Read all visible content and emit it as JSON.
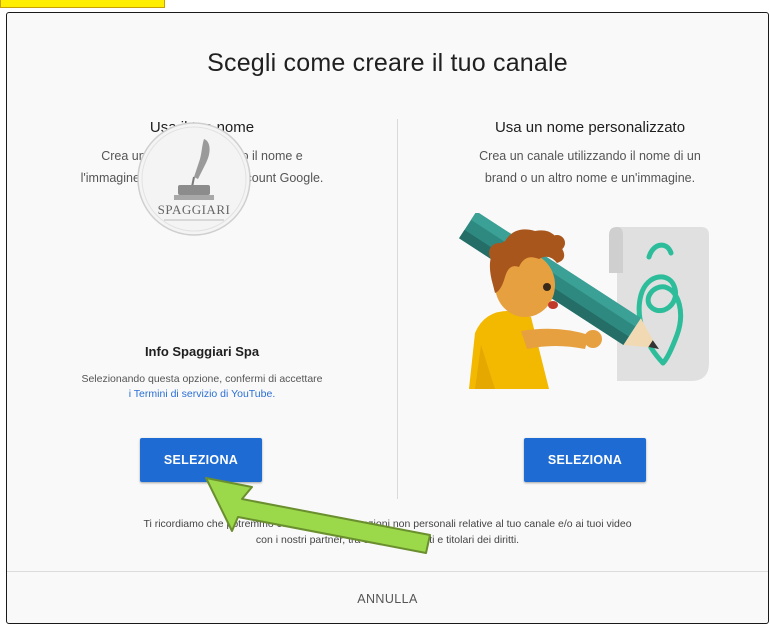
{
  "dialog": {
    "title": "Scegli come creare il tuo canale",
    "left": {
      "heading": "Usa il tuo nome",
      "description_line1": "Crea un canale utilizzando il nome e",
      "description_line2": "l'immagine presenti sul tuo Account Google.",
      "logo_text": "SPAGGIARI",
      "account_name": "Info Spaggiari Spa",
      "consent_text": "Selezionando questa opzione, confermi di accettare",
      "terms_link": "i Termini di servizio di YouTube.",
      "button_label": "SELEZIONA"
    },
    "right": {
      "heading": "Usa un nome personalizzato",
      "description_line1": "Crea un canale utilizzando il nome di un",
      "description_line2": "brand o un altro nome e un'immagine.",
      "button_label": "SELEZIONA"
    },
    "footer_line1": "Ti ricordiamo che potremmo condividere informazioni non personali relative al tuo canale e/o ai tuoi video",
    "footer_line2": "con i nostri partner, tra cui inserzionisti e titolari dei diritti.",
    "cancel_label": "ANNULLA"
  },
  "colors": {
    "primary_button": "#1e6bd3",
    "link": "#2b6fd6",
    "highlight_tab": "#ffee00",
    "arrow": "#9bd84a"
  }
}
